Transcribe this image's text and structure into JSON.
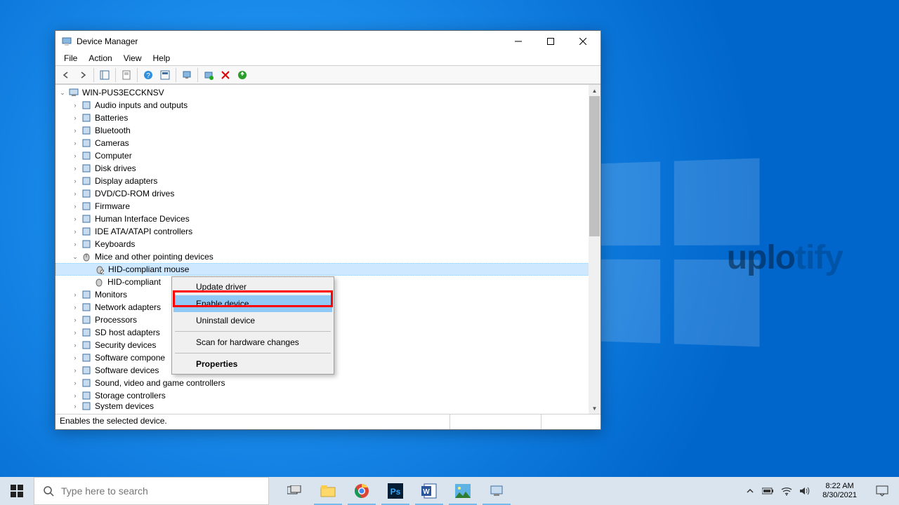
{
  "watermark": {
    "main": "uplo",
    "faded": "tify"
  },
  "window": {
    "title": "Device Manager",
    "menus": [
      "File",
      "Action",
      "View",
      "Help"
    ],
    "status": "Enables the selected device."
  },
  "tree": {
    "root": "WIN-PUS3ECCKNSV",
    "categories": [
      "Audio inputs and outputs",
      "Batteries",
      "Bluetooth",
      "Cameras",
      "Computer",
      "Disk drives",
      "Display adapters",
      "DVD/CD-ROM drives",
      "Firmware",
      "Human Interface Devices",
      "IDE ATA/ATAPI controllers",
      "Keyboards"
    ],
    "expanded_category": "Mice and other pointing devices",
    "expanded_children": [
      "HID-compliant mouse",
      "HID-compliant"
    ],
    "categories_after": [
      "Monitors",
      "Network adapters",
      "Processors",
      "SD host adapters",
      "Security devices",
      "Software compone",
      "Software devices",
      "Sound, video and game controllers",
      "Storage controllers",
      "System devices"
    ]
  },
  "context_menu": {
    "items": [
      {
        "label": "Update driver",
        "hl": false
      },
      {
        "label": "Enable device",
        "hl": true
      },
      {
        "label": "Uninstall device",
        "hl": false
      }
    ],
    "scan": "Scan for hardware changes",
    "properties": "Properties"
  },
  "taskbar": {
    "search_placeholder": "Type here to search",
    "time": "8:22 AM",
    "date": "8/30/2021"
  }
}
